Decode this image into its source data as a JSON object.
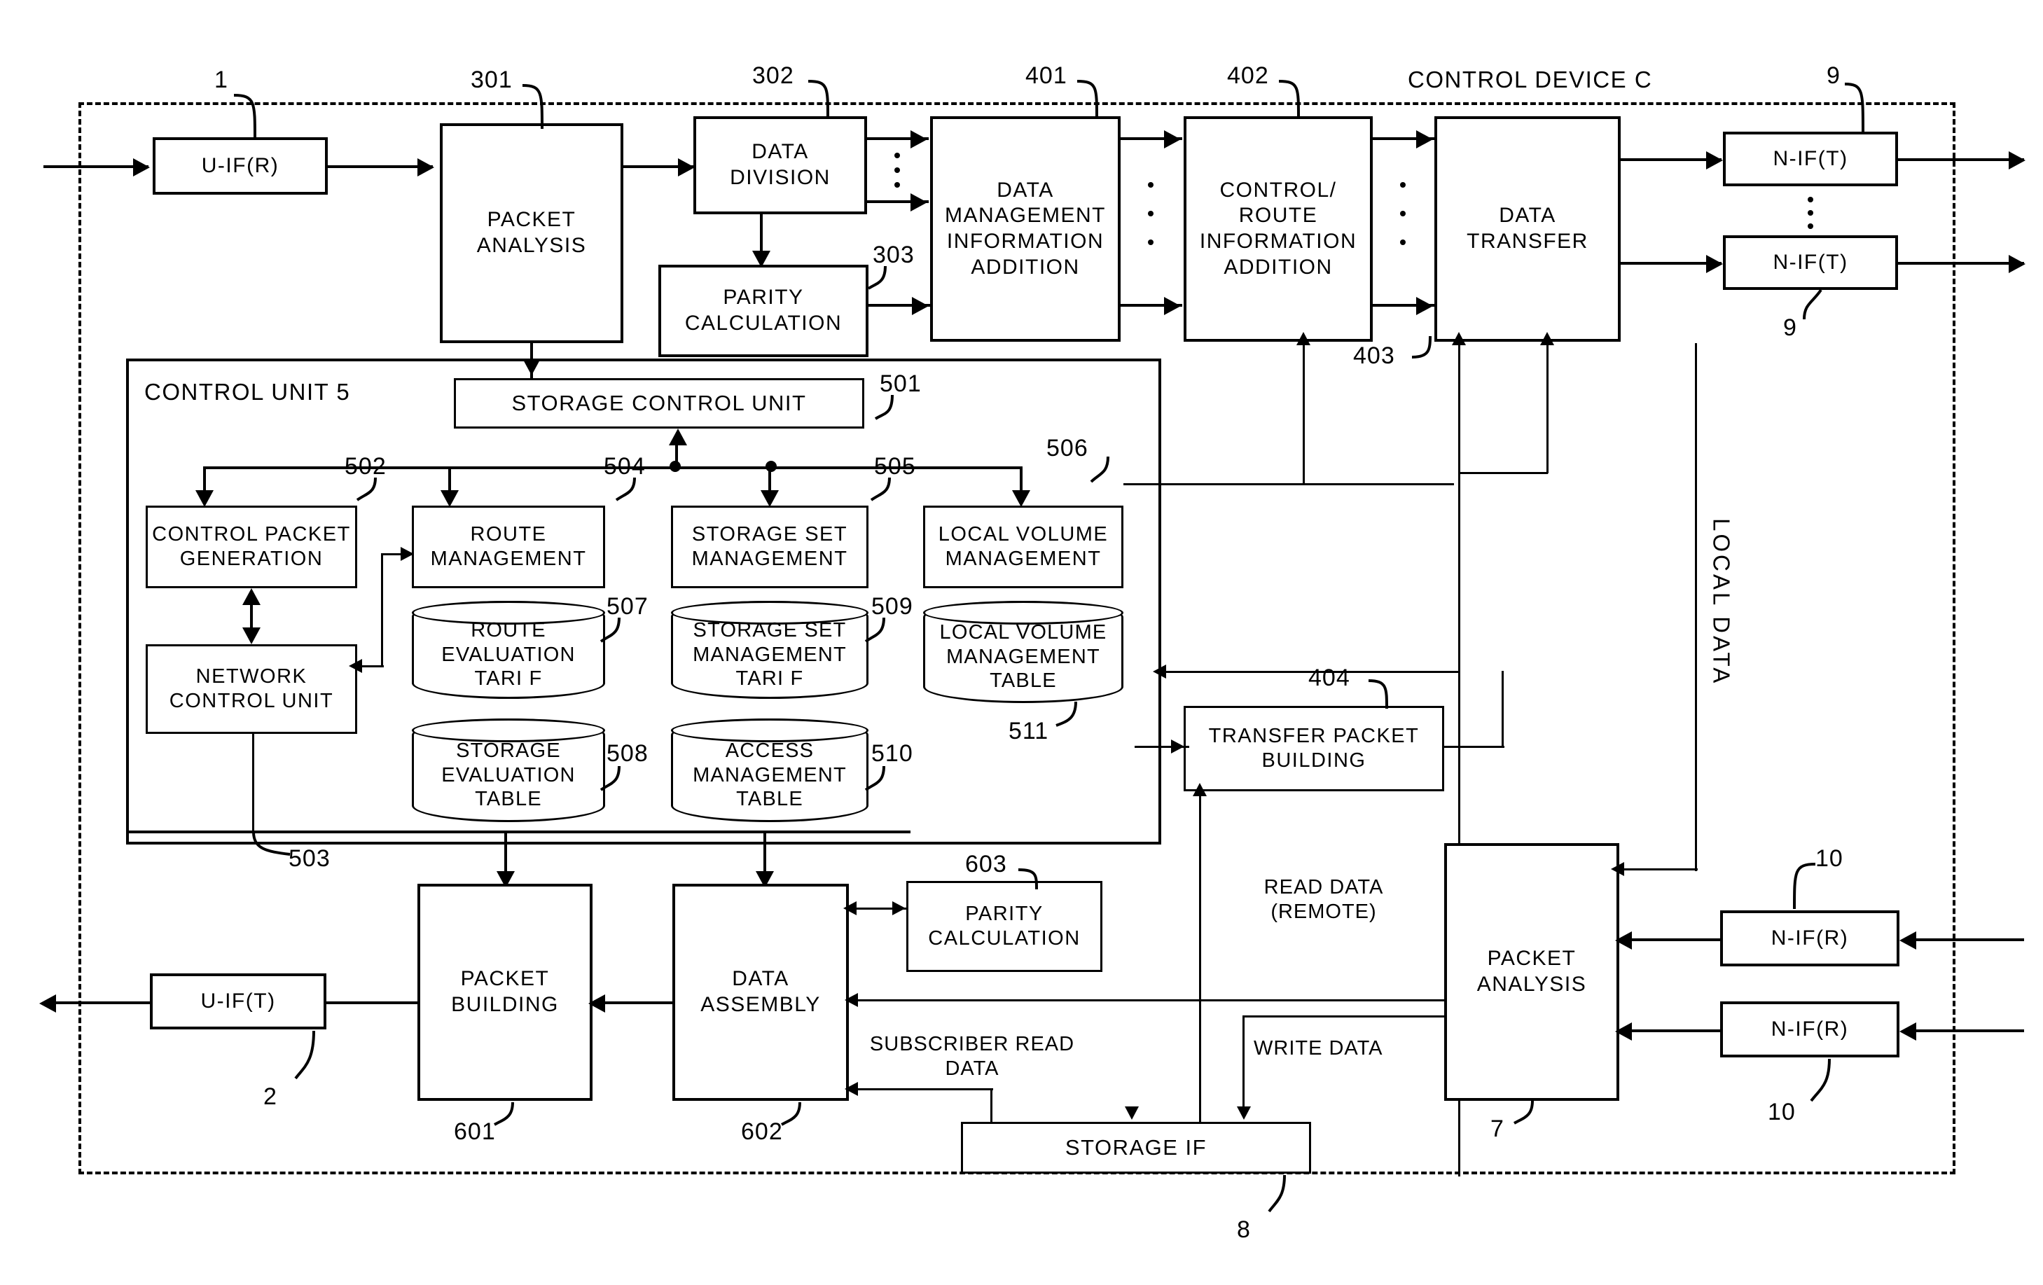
{
  "figure": {
    "boundary_label": "CONTROL DEVICE C",
    "control_unit_label": "CONTROL UNIT 5"
  },
  "blocks": {
    "u_if_r": "U-IF(R)",
    "packet_analysis_in": "PACKET\nANALYSIS",
    "data_division": "DATA\nDIVISION",
    "parity_calculation_top": "PARITY\nCALCULATION",
    "data_mgmt_info_addition": "DATA\nMANAGEMENT\nINFORMATION\nADDITION",
    "control_route_info_addition": "CONTROL/\nROUTE\nINFORMATION\nADDITION",
    "data_transfer": "DATA\nTRANSFER",
    "n_if_t_1": "N-IF(T)",
    "n_if_t_2": "N-IF(T)",
    "storage_control_unit": "STORAGE CONTROL UNIT",
    "control_packet_generation": "CONTROL PACKET\nGENERATION",
    "route_management": "ROUTE\nMANAGEMENT",
    "storage_set_management": "STORAGE SET\nMANAGEMENT",
    "local_volume_management": "LOCAL VOLUME\nMANAGEMENT",
    "network_control_unit": "NETWORK\nCONTROL UNIT",
    "route_evaluation_table": "ROUTE\nEVALUATION\nTARI F",
    "storage_set_management_table": "STORAGE SET\nMANAGEMENT\nTARI F",
    "local_volume_management_table": "LOCAL VOLUME\nMANAGEMENT\nTABLE",
    "storage_evaluation_table": "STORAGE\nEVALUATION\nTABLE",
    "access_management_table": "ACCESS\nMANAGEMENT\nTABLE",
    "transfer_packet_building": "TRANSFER PACKET\nBUILDING",
    "packet_analysis_out": "PACKET\nANALYSIS",
    "n_if_r_1": "N-IF(R)",
    "n_if_r_2": "N-IF(R)",
    "u_if_t": "U-IF(T)",
    "packet_building": "PACKET\nBUILDING",
    "data_assembly": "DATA\nASSEMBLY",
    "parity_calculation_bottom": "PARITY\nCALCULATION",
    "storage_if": "STORAGE IF"
  },
  "refs": {
    "r1": "1",
    "r2": "2",
    "r7": "7",
    "r8": "8",
    "r9_top": "9",
    "r9_bottom": "9",
    "r10_top": "10",
    "r10_bottom": "10",
    "r301": "301",
    "r302": "302",
    "r303": "303",
    "r401": "401",
    "r402": "402",
    "r403": "403",
    "r404": "404",
    "r501": "501",
    "r502": "502",
    "r503": "503",
    "r504": "504",
    "r505": "505",
    "r506": "506",
    "r507": "507",
    "r508": "508",
    "r509": "509",
    "r510": "510",
    "r511": "511",
    "r601": "601",
    "r602": "602",
    "r603": "603"
  },
  "annotations": {
    "local_data": "LOCAL DATA",
    "read_data_remote": "READ DATA\n(REMOTE)",
    "write_data": "WRITE DATA",
    "subscriber_read_data": "SUBSCRIBER READ\nDATA"
  },
  "colors": {
    "ink": "#000000",
    "paper": "#ffffff"
  }
}
